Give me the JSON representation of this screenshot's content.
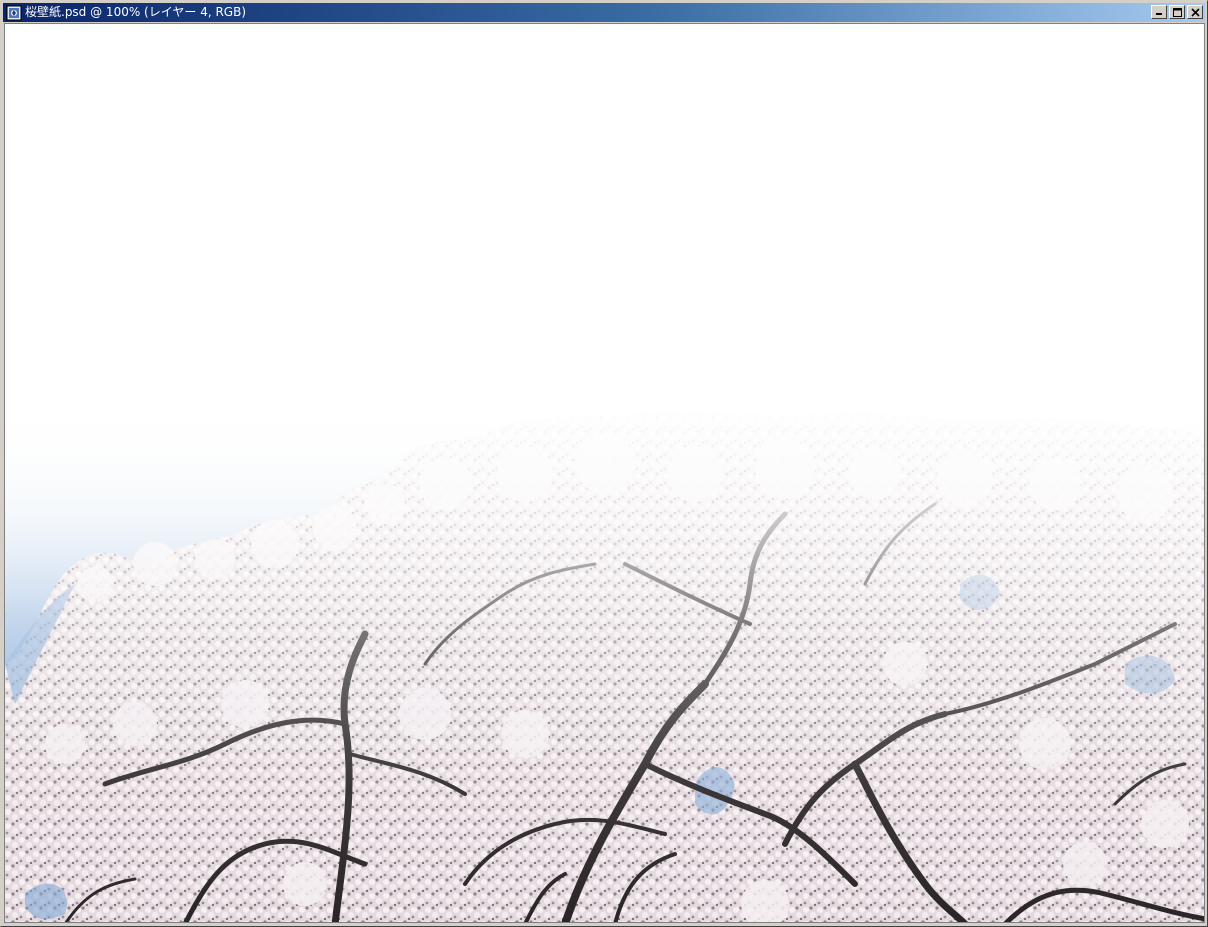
{
  "window": {
    "title": "桜壁紙.psd @ 100% (レイヤー 4, RGB)"
  },
  "caption_buttons": {
    "minimize": "minimize-icon",
    "maximize": "maximize-icon",
    "close": "close-icon"
  },
  "colors": {
    "titlebar_start": "#0a246a",
    "titlebar_end": "#a6caf0",
    "sky": "#7ea6d6",
    "blossom": "#e8dde2",
    "branch": "#2a2526"
  }
}
